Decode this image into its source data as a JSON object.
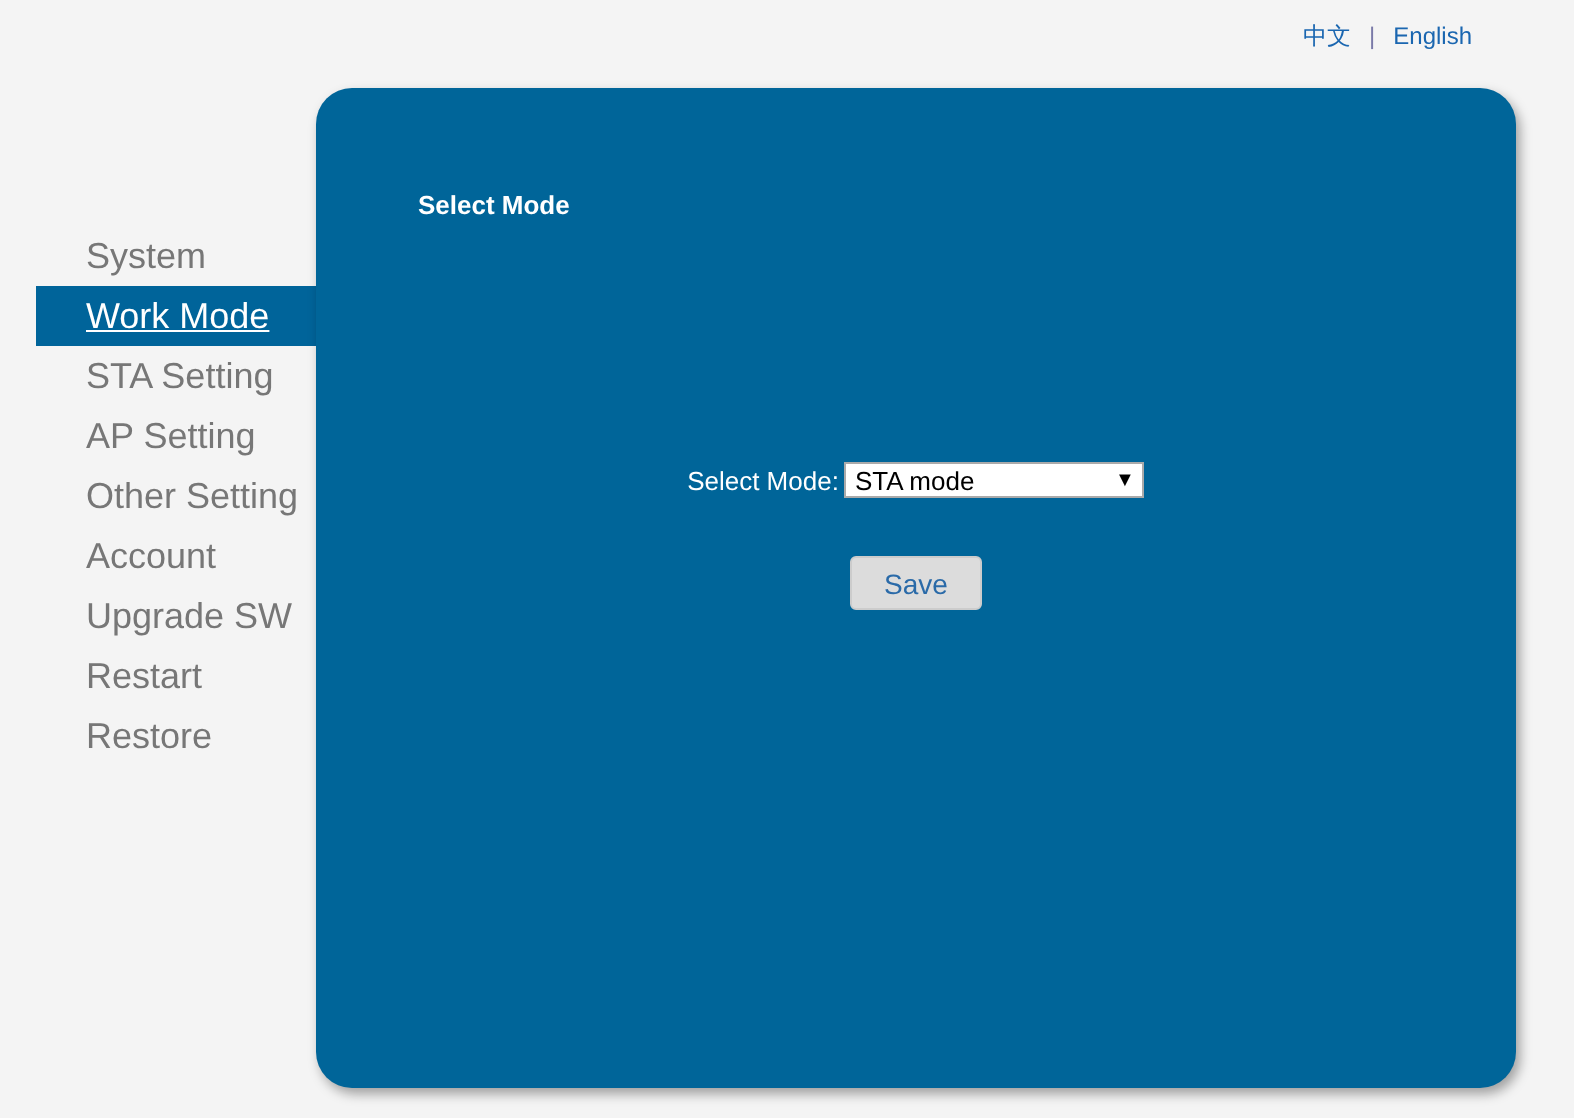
{
  "language_links": [
    {
      "label": "中文"
    },
    {
      "label": "English"
    }
  ],
  "language_separator": "|",
  "sidebar": {
    "items": [
      {
        "label": "System",
        "selected": false
      },
      {
        "label": "Work Mode",
        "selected": true
      },
      {
        "label": "STA Setting",
        "selected": false
      },
      {
        "label": "AP Setting",
        "selected": false
      },
      {
        "label": "Other Setting",
        "selected": false
      },
      {
        "label": "Account",
        "selected": false
      },
      {
        "label": "Upgrade SW",
        "selected": false
      },
      {
        "label": "Restart",
        "selected": false
      },
      {
        "label": "Restore",
        "selected": false
      }
    ]
  },
  "panel": {
    "title": "Select Mode",
    "field_label": "Select Mode:",
    "select": {
      "value": "STA mode",
      "arrow": "▼"
    },
    "save_button": "Save"
  }
}
